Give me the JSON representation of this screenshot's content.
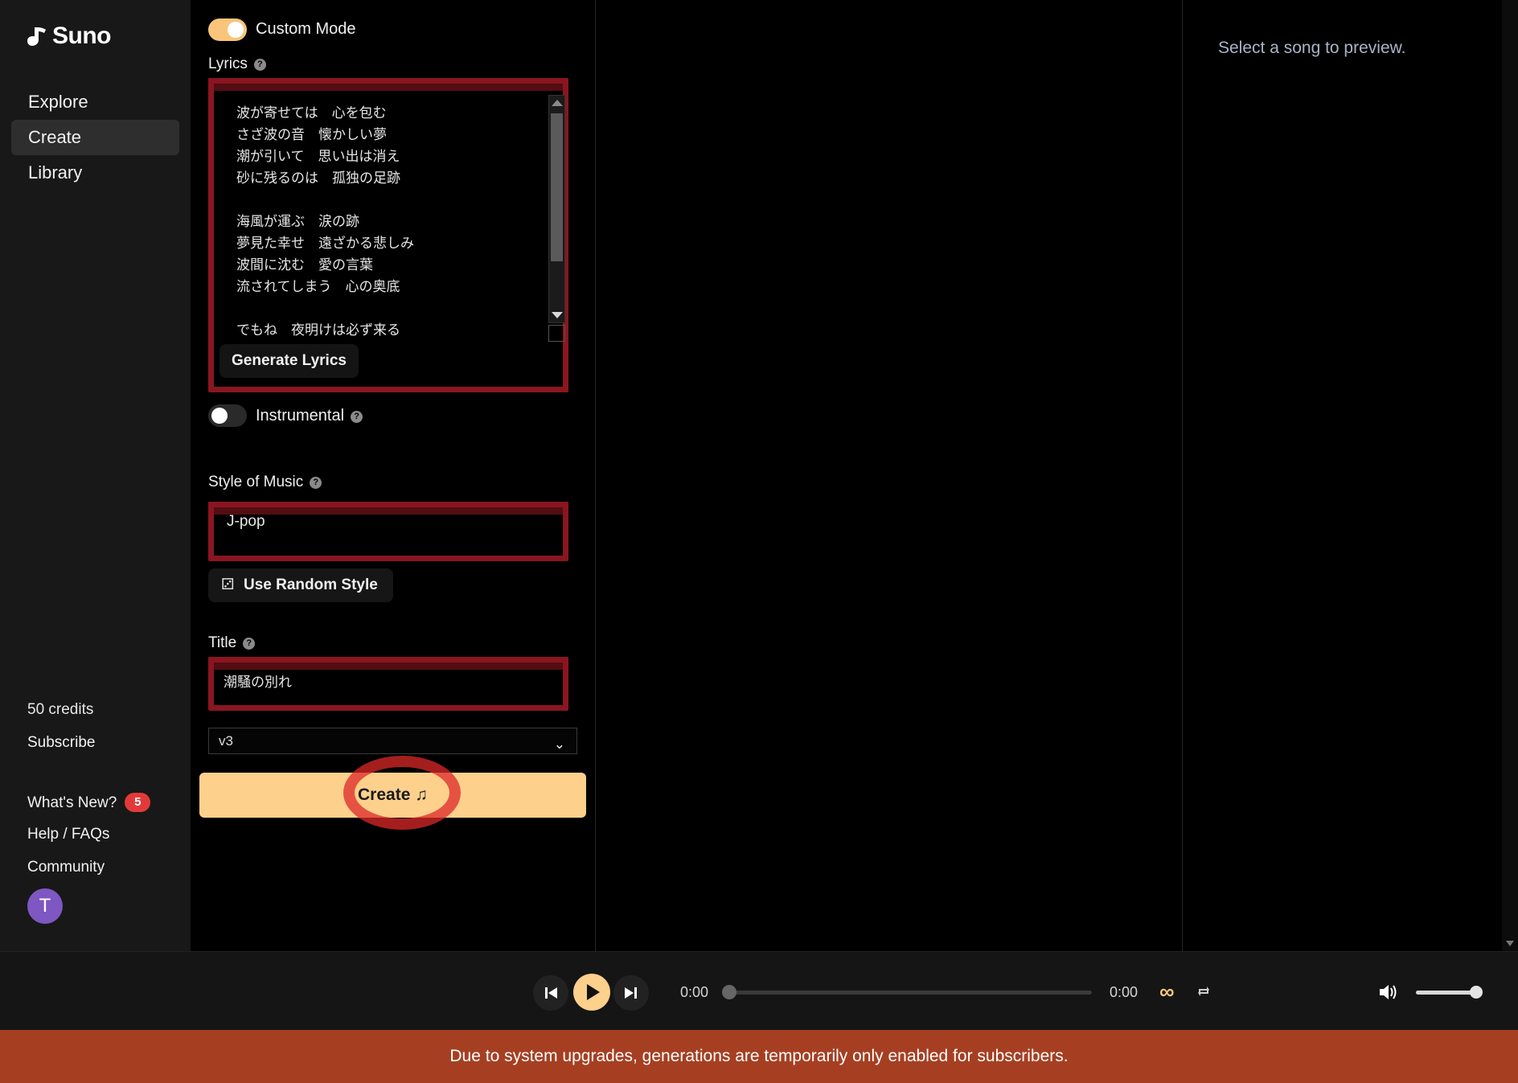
{
  "brand": {
    "name": "Suno"
  },
  "nav": [
    {
      "label": "Explore",
      "active": false
    },
    {
      "label": "Create",
      "active": true
    },
    {
      "label": "Library",
      "active": false
    }
  ],
  "sidebar_bottom": {
    "credits": "50 credits",
    "subscribe": "Subscribe",
    "whats_new": "What's New?",
    "whats_new_count": "5",
    "help": "Help / FAQs",
    "community": "Community",
    "avatar_initial": "T"
  },
  "create": {
    "custom_mode_label": "Custom Mode",
    "custom_mode_on": true,
    "lyrics_label": "Lyrics",
    "lyrics_value": "波が寄せては　心を包む\nさざ波の音　懐かしい夢\n潮が引いて　思い出は消え\n砂に残るのは　孤独の足跡\n\n海風が運ぶ　涙の跡\n夢見た幸せ　遠ざかる悲しみ\n波間に沈む　愛の言葉\n流されてしまう　心の奥底\n\nでもね　夜明けは必ず来る",
    "generate_lyrics": "Generate Lyrics",
    "instrumental_label": "Instrumental",
    "instrumental_on": false,
    "style_label": "Style of Music",
    "style_value": "J-pop",
    "random_style": "Use Random Style",
    "title_label": "Title",
    "title_value": "潮騒の別れ",
    "model_value": "v3",
    "create_button": "Create"
  },
  "preview": {
    "hint": "Select a song to preview."
  },
  "player": {
    "elapsed": "0:00",
    "duration": "0:00",
    "progress": 0,
    "volume": 0.9
  },
  "banner": {
    "text": "Due to system upgrades, generations are temporarily only enabled for subscribers."
  },
  "colors": {
    "accent": "#fdd08c",
    "banner": "#a63f22",
    "annotation_red": "#8a1620",
    "avatar": "#7e57c2",
    "badge": "#e23a3a"
  }
}
